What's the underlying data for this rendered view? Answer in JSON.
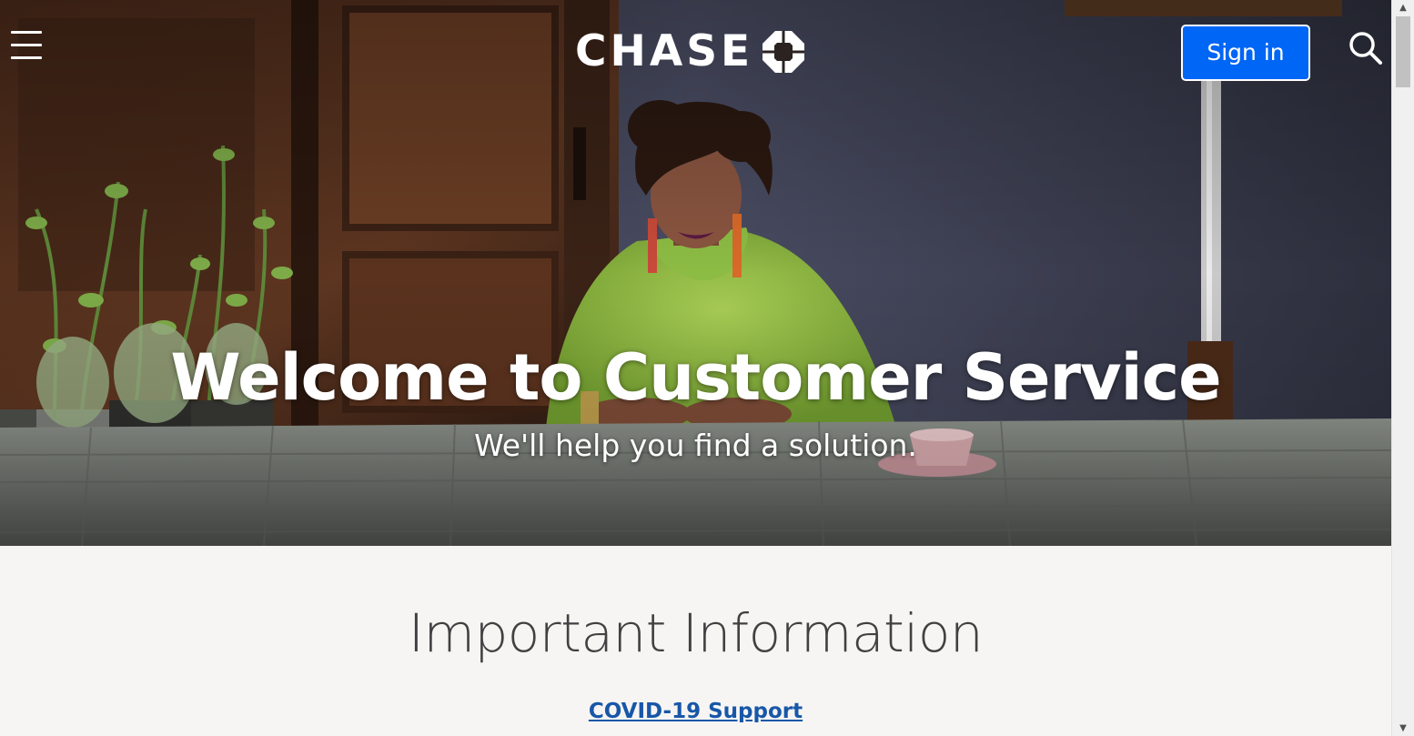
{
  "header": {
    "logo_text": "CHASE",
    "signin_label": "Sign in",
    "icons": {
      "menu": "hamburger-menu-icon",
      "search": "search-icon",
      "logo_mark": "chase-octagon-logo"
    }
  },
  "hero": {
    "title": "Welcome to Customer Service",
    "subtitle": "We'll help you find a solution."
  },
  "info": {
    "title": "Important Information",
    "link_label": "COVID-19 Support"
  },
  "colors": {
    "brand_blue": "#0066f5",
    "link_blue": "#1857a8",
    "section_bg": "#f7f5f3",
    "heading_gray": "#414042"
  }
}
